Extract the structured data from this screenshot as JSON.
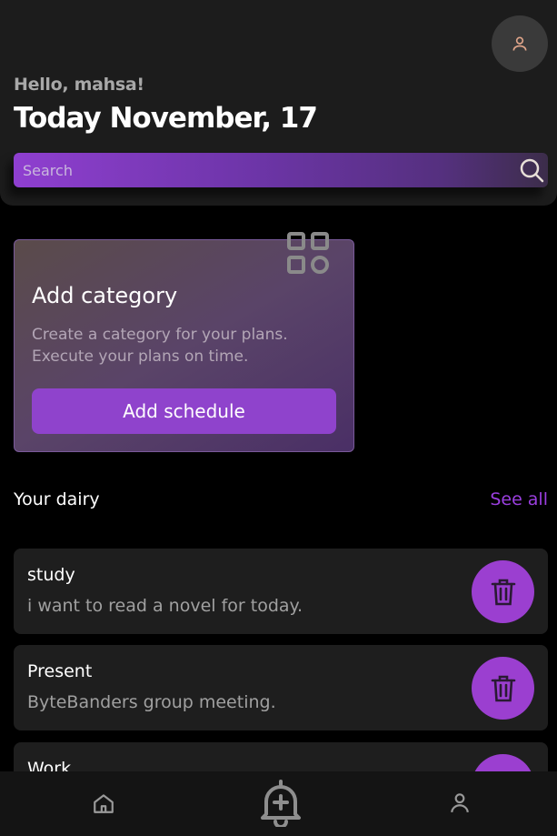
{
  "header": {
    "greeting": "Hello, mahsa!",
    "title": "Today November, 17"
  },
  "search": {
    "placeholder": "Search",
    "value": ""
  },
  "category_card": {
    "title": "Add category",
    "description_line1": "Create a category for your plans.",
    "description_line2": "Execute your plans on time.",
    "button_label": "Add schedule"
  },
  "diary": {
    "section_title": "Your dairy",
    "see_all_label": "See all",
    "items": [
      {
        "title": "study",
        "description": "i want to read a novel for today."
      },
      {
        "title": "Present",
        "description": "ByteBanders group meeting."
      },
      {
        "title": "Work",
        "description": ""
      }
    ]
  },
  "nav": {
    "items": [
      "home-icon",
      "bell-plus-icon",
      "user-icon"
    ]
  },
  "colors": {
    "accent": "#9b3fd0",
    "background": "#000000",
    "surface": "#1c1c1c"
  }
}
